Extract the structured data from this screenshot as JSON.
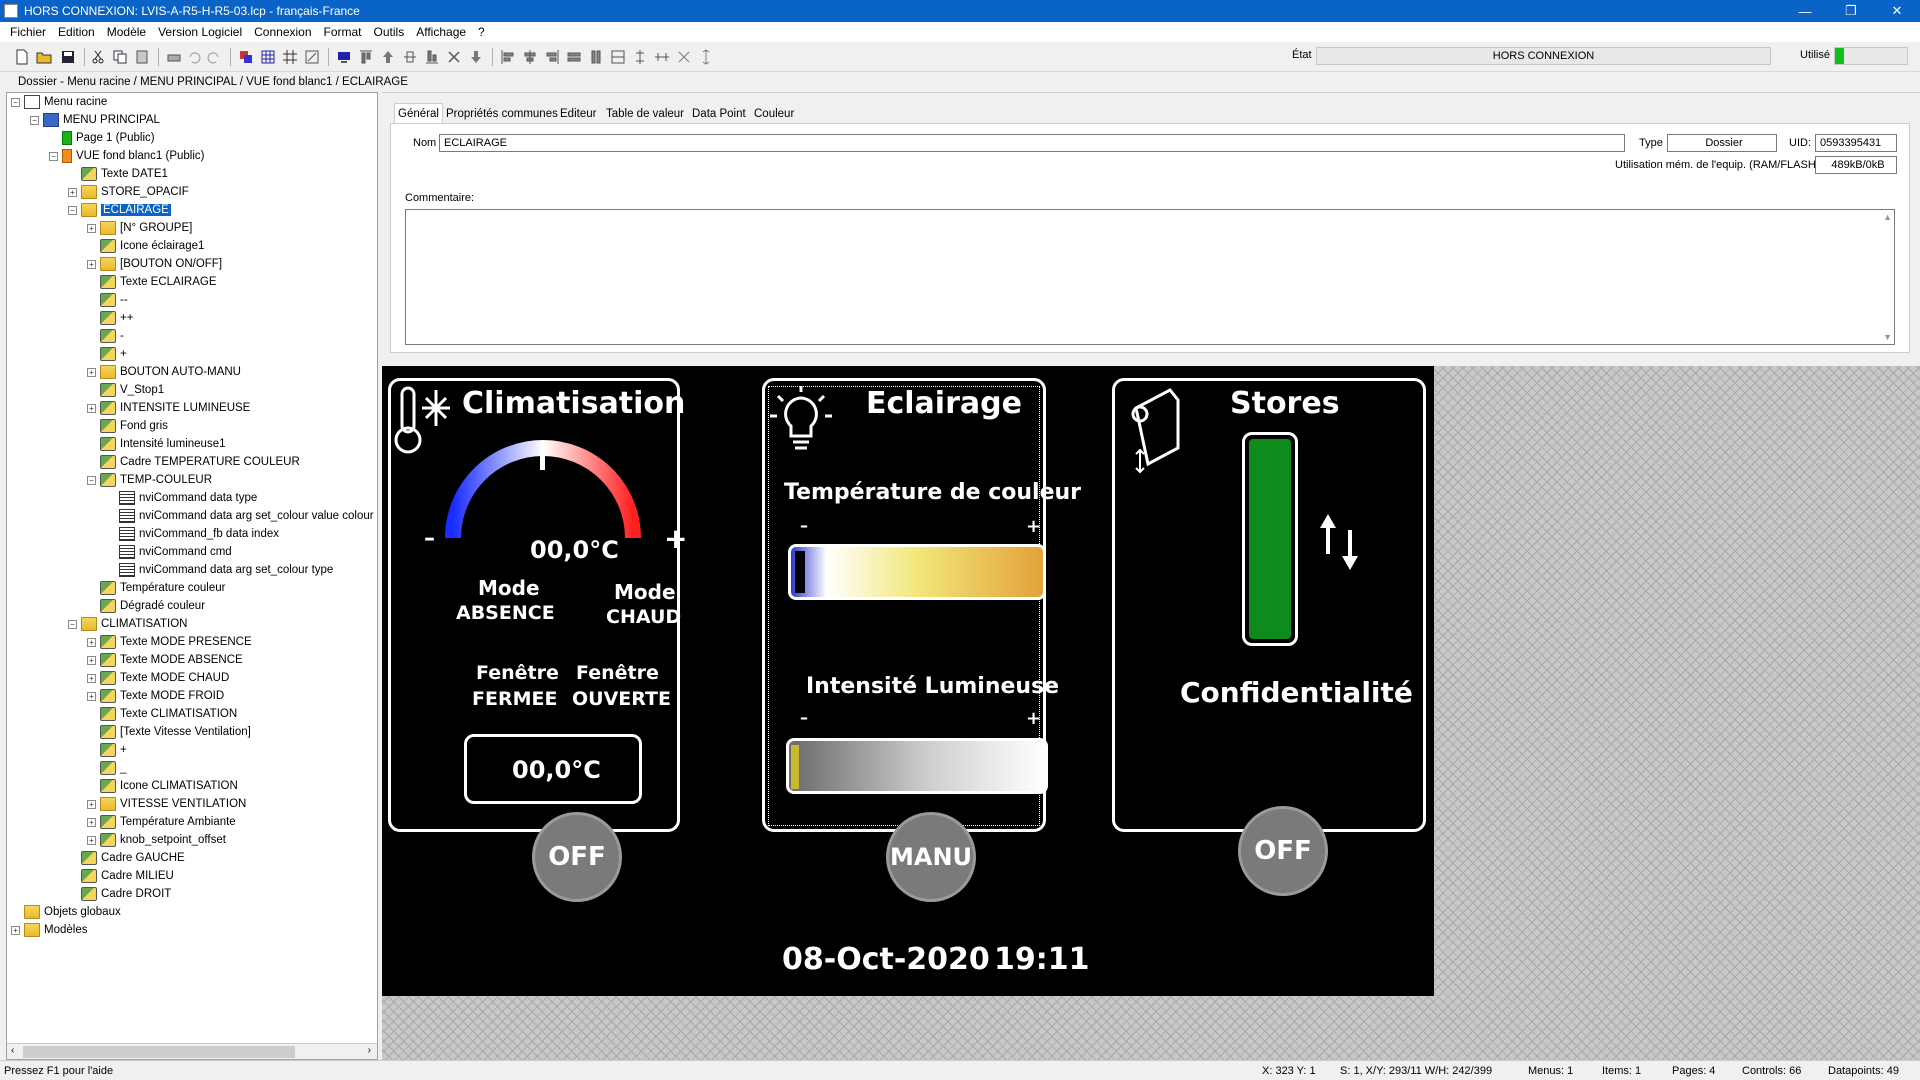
{
  "window": {
    "title": "HORS CONNEXION: LVIS-A-R5-H-R5-03.lcp - français-France",
    "controls": [
      "—",
      "❐",
      "✕"
    ]
  },
  "menu": [
    "Fichier",
    "Edition",
    "Modèle",
    "Version Logiciel",
    "Connexion",
    "Format",
    "Outils",
    "Affichage",
    "?"
  ],
  "toolbar": {
    "etat_label": "État",
    "etat_value": "HORS CONNEXION",
    "utilise_label": "Utilisé",
    "utilise_fraction": 0.12,
    "utilise_color": "#0fbf1f"
  },
  "breadcrumb": "Dossier - Menu racine / MENU PRINCIPAL / VUE fond blanc1 / ECLAIRAGE",
  "tree": [
    {
      "label": "Menu racine",
      "level": 0,
      "icon": "root",
      "exp": "−"
    },
    {
      "label": "MENU PRINCIPAL",
      "level": 1,
      "icon": "menu",
      "exp": "−"
    },
    {
      "label": "Page 1 (Public)",
      "level": 2,
      "icon": "page",
      "exp": ""
    },
    {
      "label": "VUE fond blanc1 (Public)",
      "level": 2,
      "icon": "pageo",
      "exp": "−"
    },
    {
      "label": "Texte  DATE1",
      "level": 3,
      "icon": "obj",
      "exp": ""
    },
    {
      "label": "STORE_OPACIF",
      "level": 3,
      "icon": "folder",
      "exp": "+"
    },
    {
      "label": "ECLAIRAGE",
      "level": 3,
      "icon": "folder",
      "exp": "−",
      "selected": true
    },
    {
      "label": "[N° GROUPE]",
      "level": 4,
      "icon": "folder",
      "exp": "+"
    },
    {
      "label": "Icone éclairage1",
      "level": 4,
      "icon": "obj",
      "exp": ""
    },
    {
      "label": "[BOUTON ON/OFF]",
      "level": 4,
      "icon": "folder",
      "exp": "+"
    },
    {
      "label": "Texte ECLAIRAGE",
      "level": 4,
      "icon": "obj",
      "exp": ""
    },
    {
      "label": "--",
      "level": 4,
      "icon": "obj",
      "exp": ""
    },
    {
      "label": "++",
      "level": 4,
      "icon": "obj",
      "exp": ""
    },
    {
      "label": "-",
      "level": 4,
      "icon": "obj",
      "exp": ""
    },
    {
      "label": "+",
      "level": 4,
      "icon": "obj",
      "exp": ""
    },
    {
      "label": "BOUTON AUTO-MANU",
      "level": 4,
      "icon": "folder",
      "exp": "+"
    },
    {
      "label": "V_Stop1",
      "level": 4,
      "icon": "obj",
      "exp": ""
    },
    {
      "label": "INTENSITE LUMINEUSE",
      "level": 4,
      "icon": "obj",
      "exp": "+"
    },
    {
      "label": "Fond gris",
      "level": 4,
      "icon": "obj",
      "exp": ""
    },
    {
      "label": "Intensité lumineuse1",
      "level": 4,
      "icon": "obj",
      "exp": ""
    },
    {
      "label": "Cadre TEMPERATURE COULEUR",
      "level": 4,
      "icon": "obj",
      "exp": ""
    },
    {
      "label": "TEMP-COULEUR",
      "level": 4,
      "icon": "obj",
      "exp": "−"
    },
    {
      "label": "nviCommand data type",
      "level": 5,
      "icon": "dp",
      "exp": ""
    },
    {
      "label": "nviCommand data arg set_colour value colour",
      "level": 5,
      "icon": "dp",
      "exp": ""
    },
    {
      "label": "nviCommand_fb data index",
      "level": 5,
      "icon": "dp",
      "exp": ""
    },
    {
      "label": "nviCommand cmd",
      "level": 5,
      "icon": "dp",
      "exp": ""
    },
    {
      "label": "nviCommand data arg set_colour type",
      "level": 5,
      "icon": "dp",
      "exp": ""
    },
    {
      "label": "Température couleur",
      "level": 4,
      "icon": "obj",
      "exp": ""
    },
    {
      "label": "Dégradé couleur",
      "level": 4,
      "icon": "obj",
      "exp": ""
    },
    {
      "label": "CLIMATISATION",
      "level": 3,
      "icon": "folder",
      "exp": "−"
    },
    {
      "label": "Texte MODE PRESENCE",
      "level": 4,
      "icon": "obj",
      "exp": "+"
    },
    {
      "label": "Texte MODE ABSENCE",
      "level": 4,
      "icon": "obj",
      "exp": "+"
    },
    {
      "label": "Texte MODE CHAUD",
      "level": 4,
      "icon": "obj",
      "exp": "+"
    },
    {
      "label": "Texte MODE FROID",
      "level": 4,
      "icon": "obj",
      "exp": "+"
    },
    {
      "label": "Texte CLIMATISATION",
      "level": 4,
      "icon": "obj",
      "exp": ""
    },
    {
      "label": "[Texte Vitesse Ventilation]",
      "level": 4,
      "icon": "obj",
      "exp": ""
    },
    {
      "label": "+",
      "level": 4,
      "icon": "obj",
      "exp": ""
    },
    {
      "label": "_",
      "level": 4,
      "icon": "obj",
      "exp": ""
    },
    {
      "label": "Icone CLIMATISATION",
      "level": 4,
      "icon": "obj",
      "exp": ""
    },
    {
      "label": "VITESSE VENTILATION",
      "level": 4,
      "icon": "folder",
      "exp": "+"
    },
    {
      "label": "Température Ambiante",
      "level": 4,
      "icon": "obj",
      "exp": "+"
    },
    {
      "label": "knob_setpoint_offset",
      "level": 4,
      "icon": "obj",
      "exp": "+"
    },
    {
      "label": "Cadre  GAUCHE",
      "level": 3,
      "icon": "obj",
      "exp": ""
    },
    {
      "label": "Cadre  MILIEU",
      "level": 3,
      "icon": "obj",
      "exp": ""
    },
    {
      "label": "Cadre  DROIT",
      "level": 3,
      "icon": "obj",
      "exp": ""
    },
    {
      "label": "Objets globaux",
      "level": 0,
      "icon": "folder",
      "exp": ""
    },
    {
      "label": "Modèles",
      "level": 0,
      "icon": "folder",
      "exp": "+"
    }
  ],
  "tabs": [
    "Général",
    "Propriétés communes",
    "Editeur",
    "Table de valeur",
    "Data Point",
    "Couleur"
  ],
  "general": {
    "nom_label": "Nom",
    "nom_value": "ECLAIRAGE",
    "type_label": "Type",
    "type_value": "Dossier",
    "uid_label": "UID:",
    "uid_value": "0593395431",
    "mem_label": "Utilisation mém. de l'equip. (RAM/FLASH)",
    "mem_value": "489kB/0kB",
    "comment_label": "Commentaire:"
  },
  "hmi": {
    "clim": {
      "title": "Climatisation",
      "minus": "–",
      "plus": "+",
      "gauge_temp": "00,0°C",
      "mode_left_1": "Mode",
      "mode_left_2": "ABSENCE",
      "mode_right_1": "Mode",
      "mode_right_2": "CHAUD",
      "fen_left_1": "Fenêtre",
      "fen_left_2": "FERMEE",
      "fen_right_1": "Fenêtre",
      "fen_right_2": "OUVERTE",
      "box_temp": "00,0°C",
      "button": "OFF"
    },
    "eclairage": {
      "title": "Eclairage",
      "temp_label": "Température de couleur",
      "minus": "–",
      "plus": "+",
      "int_label": "Intensité Lumineuse",
      "minus2": "–",
      "plus2": "+",
      "button": "MANU"
    },
    "stores": {
      "title": "Stores",
      "label": "Confidentialité",
      "button": "OFF",
      "bar_color": "#0f8a1c"
    },
    "date": "08-Oct-2020",
    "time": "19:11"
  },
  "status": {
    "help": "Pressez F1 pour l'aide",
    "xy": "X: 323 Y: 1",
    "sel": "S: 1, X/Y: 293/11 W/H: 242/399",
    "menus": "Menus: 1",
    "items": "Items: 1",
    "pages": "Pages: 4",
    "controls": "Controls: 66",
    "datapoints": "Datapoints: 49"
  }
}
